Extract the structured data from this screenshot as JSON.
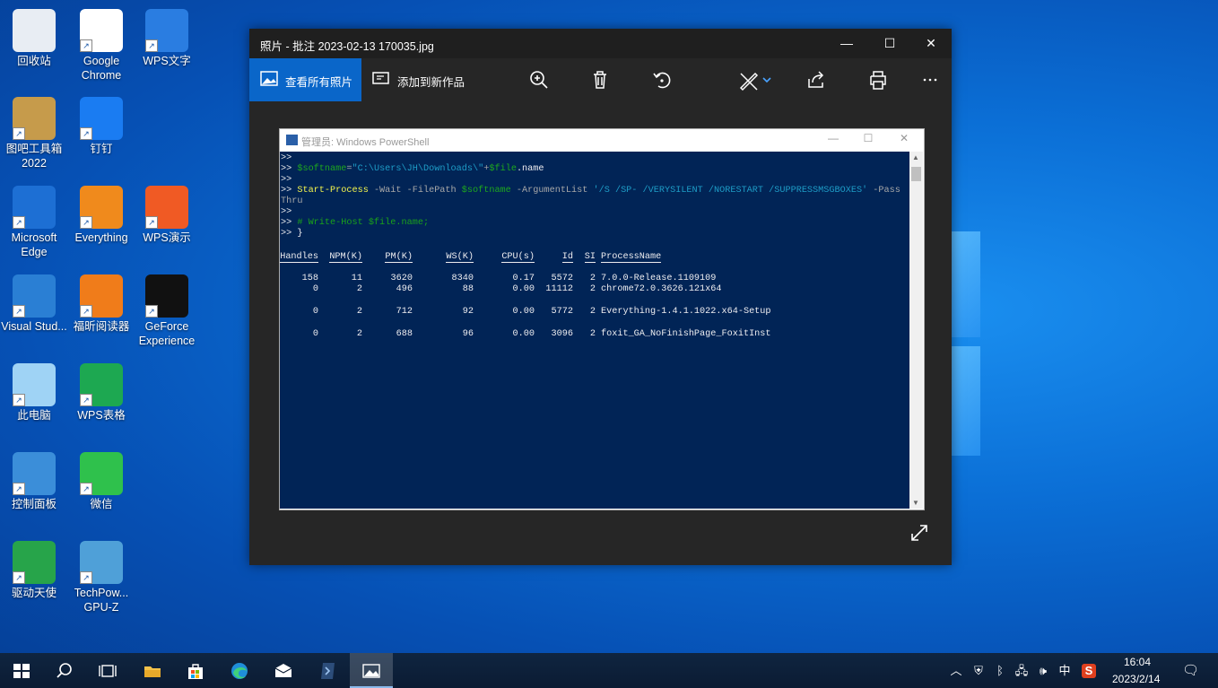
{
  "desktop": {
    "icons": [
      {
        "label": "回收站",
        "icon": "recycle-bin-icon"
      },
      {
        "label": "Google Chrome",
        "icon": "chrome-icon"
      },
      {
        "label": "WPS文字",
        "icon": "wps-writer-icon"
      },
      {
        "label": "图吧工具箱2022",
        "icon": "toolbox-icon"
      },
      {
        "label": "钉钉",
        "icon": "dingtalk-icon"
      },
      {
        "label": "Microsoft Edge",
        "icon": "edge-icon"
      },
      {
        "label": "Everything",
        "icon": "everything-icon"
      },
      {
        "label": "WPS演示",
        "icon": "wps-presentation-icon"
      },
      {
        "label": "Visual Stud...",
        "icon": "vscode-icon"
      },
      {
        "label": "福昕阅读器",
        "icon": "foxit-reader-icon"
      },
      {
        "label": "GeForce Experience",
        "icon": "geforce-icon"
      },
      {
        "label": "此电脑",
        "icon": "this-pc-icon"
      },
      {
        "label": "WPS表格",
        "icon": "wps-spreadsheet-icon"
      },
      {
        "label": "控制面板",
        "icon": "control-panel-icon"
      },
      {
        "label": "微信",
        "icon": "wechat-icon"
      },
      {
        "label": "驱动天使",
        "icon": "driver-angel-icon"
      },
      {
        "label": "TechPow... GPU-Z",
        "icon": "gpu-z-icon"
      }
    ]
  },
  "photos": {
    "title": "照片 - 批注 2023-02-13 170035.jpg",
    "see_all": "查看所有照片",
    "add_to": "添加到新作品",
    "controls": {
      "minimize": "—",
      "maximize": "☐",
      "close": "✕"
    }
  },
  "powershell": {
    "title": "管理员: Windows PowerShell",
    "lines": {
      "l0": ">>",
      "l1_prompt": ">> ",
      "l1_var": "$softname",
      "l1_eq": "=",
      "l1_str": "\"C:\\Users\\JH\\Downloads\\\"",
      "l1_plus": "+",
      "l1_file": "$file",
      "l1_name": ".name",
      "l2": ">>",
      "l3_prompt": ">> ",
      "l3_cmd": "Start-Process",
      "l3_p1": " -Wait -FilePath ",
      "l3_var": "$softname",
      "l3_p2": " -ArgumentList ",
      "l3_str": "'/S /SP- /VERYSILENT /NORESTART /SUPPRESSMSGBOXES'",
      "l3_p3": " -Pass",
      "l4": "Thru",
      "l5": ">>",
      "l6_prompt": ">> ",
      "l6_comment": "# Write-Host $file.name;",
      "l7": ">> }"
    },
    "table": {
      "headers": [
        "Handles",
        "NPM(K)",
        "PM(K)",
        "WS(K)",
        "CPU(s)",
        "Id",
        "SI",
        "ProcessName"
      ],
      "rows": [
        [
          "158",
          "11",
          "3620",
          "8340",
          "0.17",
          "5572",
          "2",
          "7.0.0-Release.1109109"
        ],
        [
          "0",
          "2",
          "496",
          "88",
          "0.00",
          "11112",
          "2",
          "chrome72.0.3626.121x64"
        ],
        [
          "0",
          "2",
          "712",
          "92",
          "0.00",
          "5772",
          "2",
          "Everything-1.4.1.1022.x64-Setup"
        ],
        [
          "0",
          "2",
          "688",
          "96",
          "0.00",
          "3096",
          "2",
          "foxit_GA_NoFinishPage_FoxitInst"
        ]
      ]
    }
  },
  "taskbar": {
    "ime": "中",
    "time": "16:04",
    "date": "2023/2/14"
  }
}
